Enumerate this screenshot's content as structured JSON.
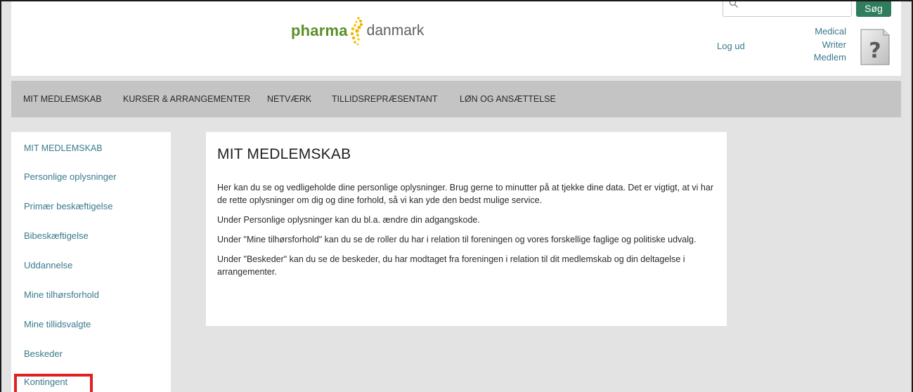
{
  "header": {
    "logo_part1": "pharma",
    "logo_part2": "danmark",
    "search_placeholder": "",
    "search_button": "Søg",
    "logout": "Log ud",
    "user_lines": [
      "Medical",
      "Writer",
      "Medlem"
    ]
  },
  "nav": {
    "items": [
      "MIT MEDLEMSKAB",
      "KURSER & ARRANGEMENTER",
      "NETVÆRK",
      "TILLIDSREPRÆSENTANT",
      "LØN OG ANSÆTTELSE"
    ]
  },
  "sidebar": {
    "items": [
      "MIT MEDLEMSKAB",
      "Personlige oplysninger",
      "Primær beskæftigelse",
      "Bibeskæftigelse",
      "Uddannelse",
      "Mine tilhørsforhold",
      "Mine tillidsvalgte",
      "Beskeder",
      "Kontingent"
    ]
  },
  "main": {
    "title": "MIT MEDLEMSKAB",
    "paragraphs": [
      "Her kan du se og vedligeholde dine personlige oplysninger. Brug gerne to minutter på at tjekke dine data. Det er vigtigt, at vi har de rette oplysninger om dig og dine forhold, så vi kan yde den bedst mulige service.",
      "Under Personlige oplysninger kan du bl.a. ændre din adgangskode.",
      "Under \"Mine tilhørsforhold\" kan du se de roller du har i relation til foreningen og vores forskellige faglige og politiske udvalg.",
      "Under \"Beskeder\" kan du se de beskeder, du har modtaget fra foreningen i relation til dit medlemskab og din deltagelse i arrangementer."
    ]
  },
  "colors": {
    "brand_green": "#5a8f28",
    "link_teal": "#3a7a8c",
    "button_green": "#2f7d5d",
    "highlight_red": "#e02020"
  }
}
